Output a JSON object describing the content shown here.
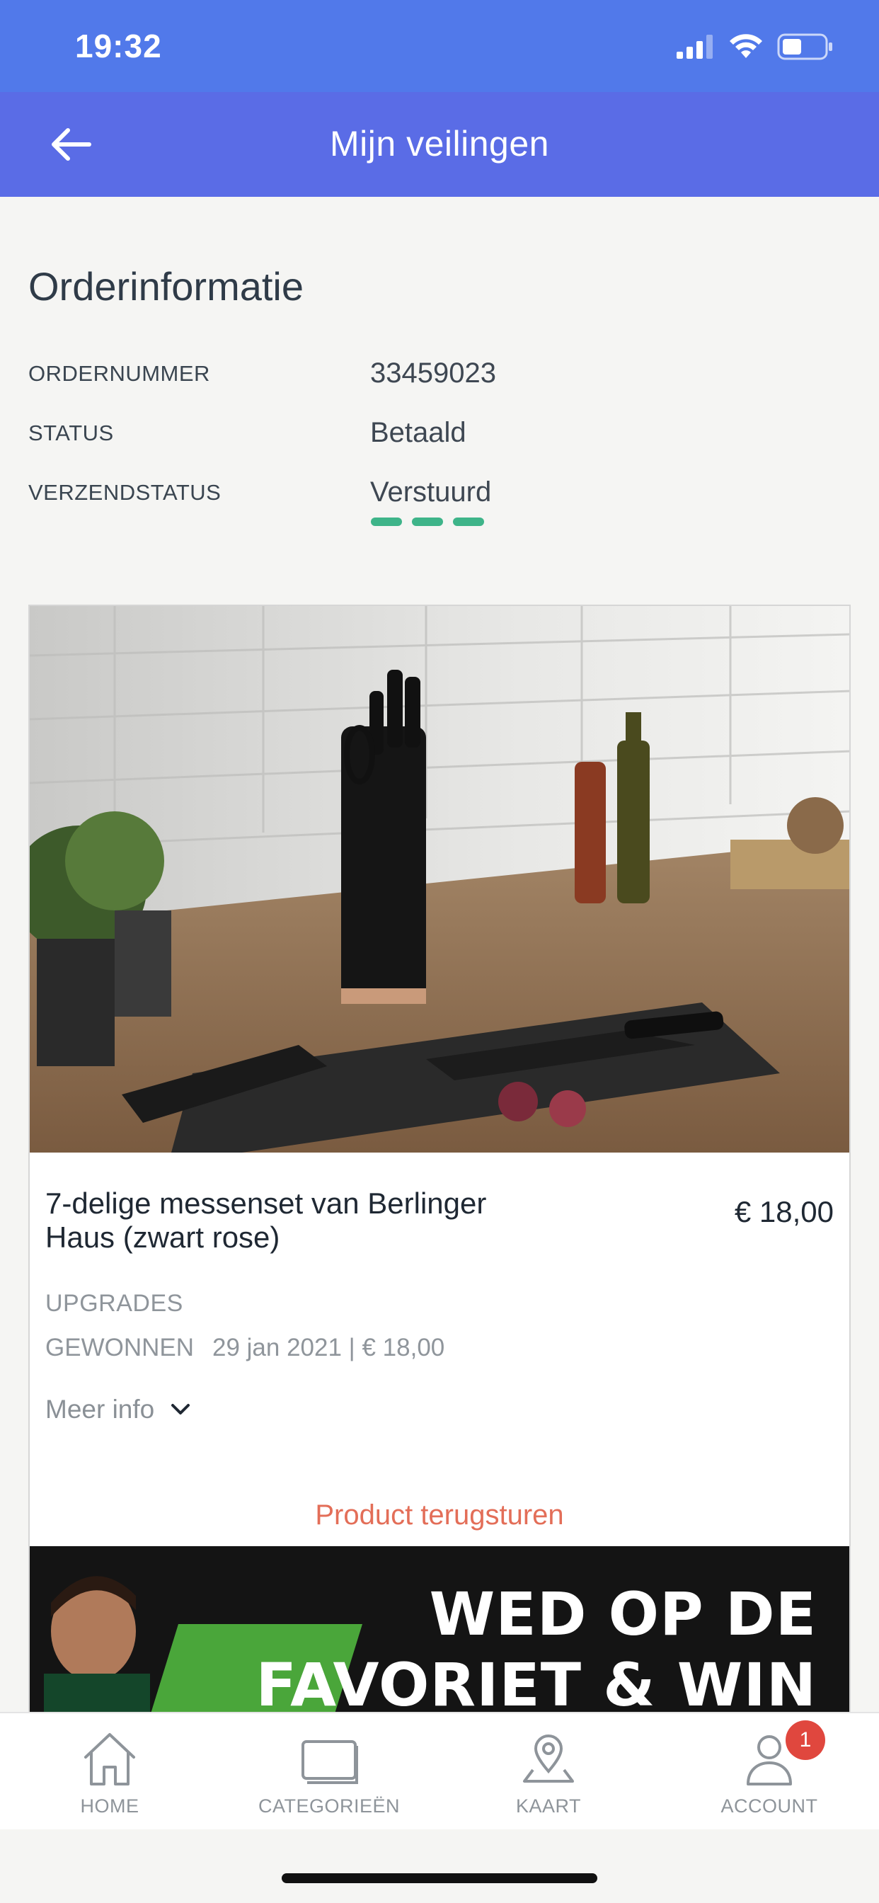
{
  "status_bar": {
    "time": "19:32"
  },
  "header": {
    "title": "Mijn veilingen"
  },
  "order": {
    "section_title": "Orderinformatie",
    "rows": [
      {
        "label": "ORDERNUMMER",
        "value": "33459023"
      },
      {
        "label": "STATUS",
        "value": "Betaald"
      },
      {
        "label": "VERZENDSTATUS",
        "value": "Verstuurd"
      }
    ]
  },
  "product": {
    "title": "7-delige messenset van Berlinger Haus (zwart rose)",
    "price": "€ 18,00",
    "upgrades_label": "UPGRADES",
    "won_label": "GEWONNEN",
    "won_detail": "29 jan 2021 | € 18,00",
    "more_info": "Meer info",
    "return_link": "Product terugsturen"
  },
  "banner": {
    "line1": "WED OP DE",
    "line2": "FAVORIET & WIN"
  },
  "tabs": [
    {
      "label": "HOME",
      "icon": "home-icon"
    },
    {
      "label": "CATEGORIEËN",
      "icon": "categories-icon"
    },
    {
      "label": "KAART",
      "icon": "map-pin-icon"
    },
    {
      "label": "ACCOUNT",
      "icon": "account-icon",
      "badge": "1"
    }
  ],
  "colors": {
    "status_bar": "#5179ea",
    "header": "#5a6ce6",
    "shipping_accent": "#3eb489",
    "return_link": "#e36e58",
    "badge": "#e0473e"
  }
}
